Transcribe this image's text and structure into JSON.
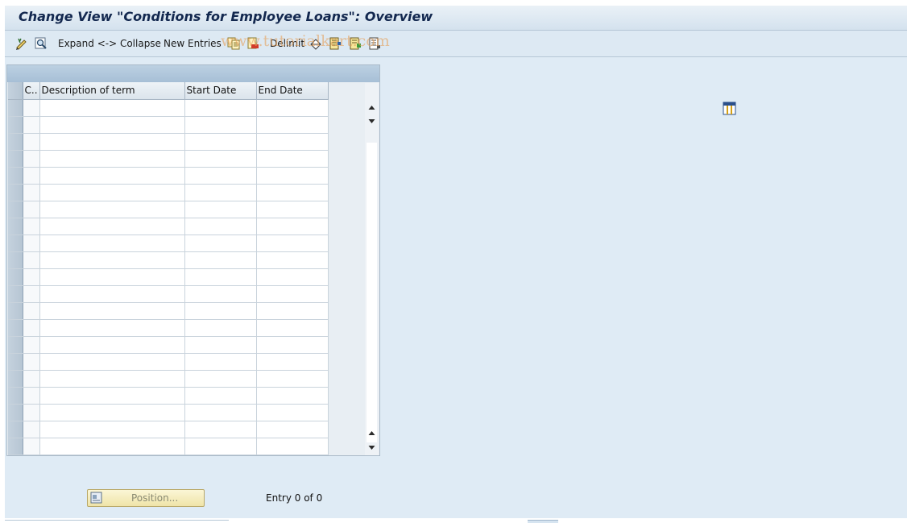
{
  "window": {
    "title": "Change View \"Conditions for Employee Loans\": Overview"
  },
  "toolbar": {
    "icons": [
      "edit-pencil-icon",
      "display-glasses-icon",
      "copy-icon",
      "delete-icon",
      "undo-icon",
      "select-all-icon",
      "select-block-icon",
      "deselect-all-icon"
    ],
    "expand_collapse_label": "Expand <-> Collapse",
    "new_entries_label": "New Entries",
    "delimit_label": "Delimit",
    "watermark": "www.tutorialkart.com"
  },
  "table": {
    "columns": [
      "C..",
      "Description of term",
      "Start Date",
      "End Date"
    ],
    "rows": [],
    "visible_empty_rows": 21
  },
  "footer": {
    "position_button_label": "Position...",
    "entry_text": "Entry 0 of 0"
  },
  "colors": {
    "background": "#dfebf5",
    "title_text": "#13284f",
    "position_button": "#f5edc0"
  }
}
